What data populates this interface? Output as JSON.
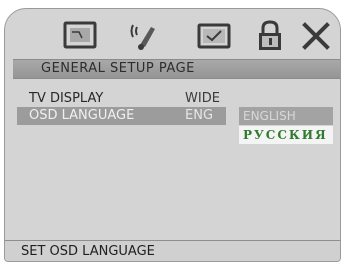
{
  "toolbar": {
    "icons": [
      {
        "name": "tv-display-icon"
      },
      {
        "name": "audio-icon"
      },
      {
        "name": "video-icon"
      },
      {
        "name": "lock-icon"
      },
      {
        "name": "close-icon"
      }
    ]
  },
  "page": {
    "title": "GENERAL SETUP PAGE"
  },
  "settings": [
    {
      "label": "TV DISPLAY",
      "value": "WIDE"
    },
    {
      "label": "OSD LANGUAGE",
      "value": "ENG"
    }
  ],
  "options": [
    {
      "label": "ENGLISH"
    },
    {
      "label": "РУССКИЯ"
    }
  ],
  "status": {
    "text": "SET OSD LANGUAGE"
  },
  "colors": {
    "panel_background": "#d4d4d4",
    "title_bar": "#a0a0a0",
    "highlight": "#9c9c9c",
    "russian_option_text": "#2e7a2e"
  }
}
